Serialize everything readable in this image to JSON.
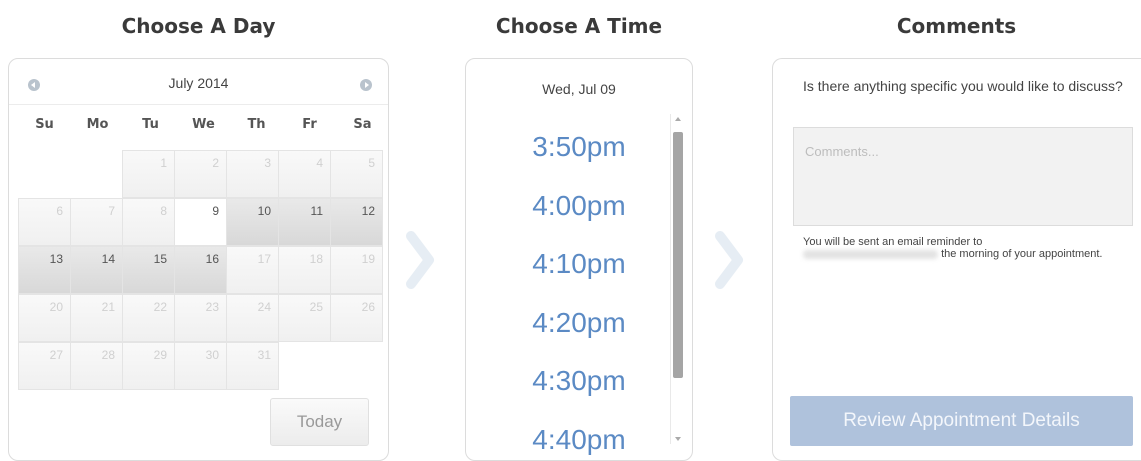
{
  "steps": {
    "day": "Choose A Day",
    "time": "Choose A Time",
    "comments": "Comments"
  },
  "calendar": {
    "month": "July 2014",
    "weekdays": [
      "Su",
      "Mo",
      "Tu",
      "We",
      "Th",
      "Fr",
      "Sa"
    ],
    "weeks": [
      [
        "",
        "",
        "1",
        "2",
        "3",
        "4",
        "5"
      ],
      [
        "6",
        "7",
        "8",
        "9",
        "10",
        "11",
        "12"
      ],
      [
        "13",
        "14",
        "15",
        "16",
        "17",
        "18",
        "19"
      ],
      [
        "20",
        "21",
        "22",
        "23",
        "24",
        "25",
        "26"
      ],
      [
        "27",
        "28",
        "29",
        "30",
        "31",
        "",
        ""
      ]
    ],
    "selected": "9",
    "available": [
      "10",
      "11",
      "12",
      "13",
      "14",
      "15",
      "16"
    ],
    "today_label": "Today"
  },
  "times": {
    "date": "Wed, Jul 09",
    "slots": [
      "3:50pm",
      "4:00pm",
      "4:10pm",
      "4:20pm",
      "4:30pm",
      "4:40pm"
    ]
  },
  "comments": {
    "question": "Is there anything specific you would like to discuss?",
    "placeholder": "Comments...",
    "reminder_prefix": "You will be sent an email reminder to",
    "reminder_suffix": "the morning of your appointment.",
    "review_label": "Review Appointment Details"
  },
  "colors": {
    "time_text": "#5b8ac4",
    "review_button": "#afc2dc",
    "available_day": "#dddddd"
  }
}
